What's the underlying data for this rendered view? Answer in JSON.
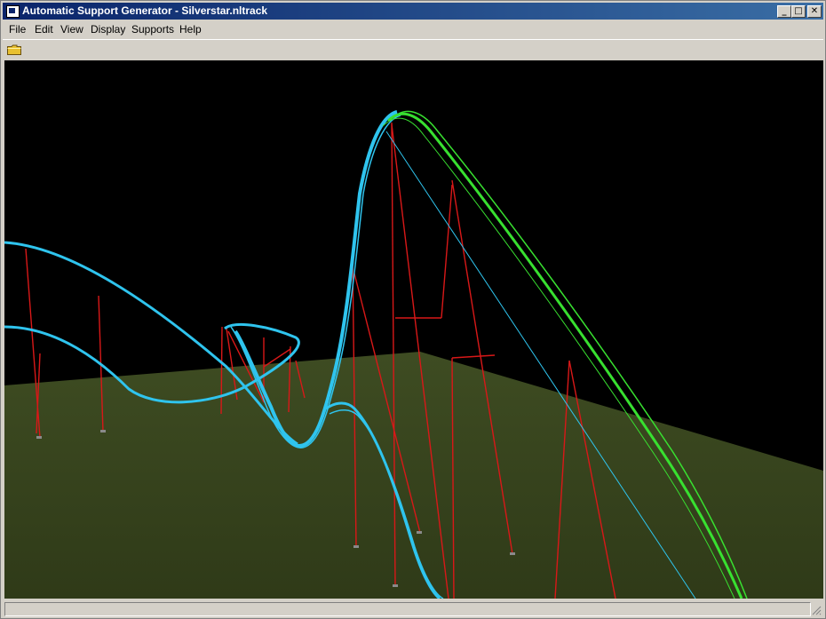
{
  "window": {
    "title": "Automatic Support Generator - Silverstar.nltrack",
    "controls": {
      "minimize": "_",
      "maximize": "□",
      "close": "✕"
    }
  },
  "menu": {
    "items": [
      "File",
      "Edit",
      "View",
      "Display",
      "Supports",
      "Help"
    ]
  },
  "toolbar": {
    "open_icon": "folder-icon"
  },
  "scene": {
    "background": "#000000",
    "ground_color": "#3c4a20",
    "track_color": "#2fc4ee",
    "selected_track_color": "#38e030",
    "support_color": "#d81818"
  },
  "statusbar": {
    "text": ""
  }
}
